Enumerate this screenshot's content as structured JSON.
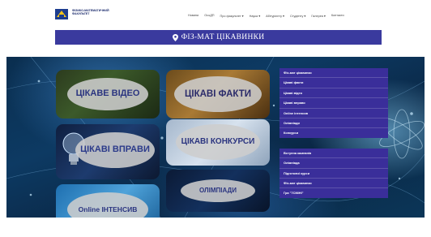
{
  "header": {
    "logo_text": "ФІЗИКО-МАТЕМАТИЧНИЙ ФАКУЛЬТЕТ",
    "nav": [
      "Новини",
      "ОсоДП",
      "Про факультет ▾",
      "Наука ▾",
      "Абітурієнту ▾",
      "Студенту ▾",
      "Галерея ▾",
      "Контакти"
    ]
  },
  "banner": {
    "title": "ФІЗ-МАТ ЦІКАВИНКИ"
  },
  "tiles": {
    "video": "ЦІКАВЕ ВІДЕО",
    "facts": "ЦІКАВІ ФАКТИ",
    "vpravy": "ЦІКАВІ ВПРАВИ",
    "konkursy": "ЦІКАВІ КОНКУРСИ",
    "online": "Online ІНТЕНСИВ",
    "olimpiady": "ОЛІМПІАДИ"
  },
  "menu": {
    "group1": [
      "Фіз-мат цікавинки",
      "Цікаві факти",
      "Цікаві відео",
      "Цікаві вправи",
      "Online інтенсив",
      "Олімпіади",
      "Конкурси"
    ],
    "group2": [
      "Вступна кампанія",
      "Олімпіада",
      "Підготовчі курси",
      "Фіз-мат цікавинки",
      "Гра \"7СМІНІ\""
    ]
  }
}
